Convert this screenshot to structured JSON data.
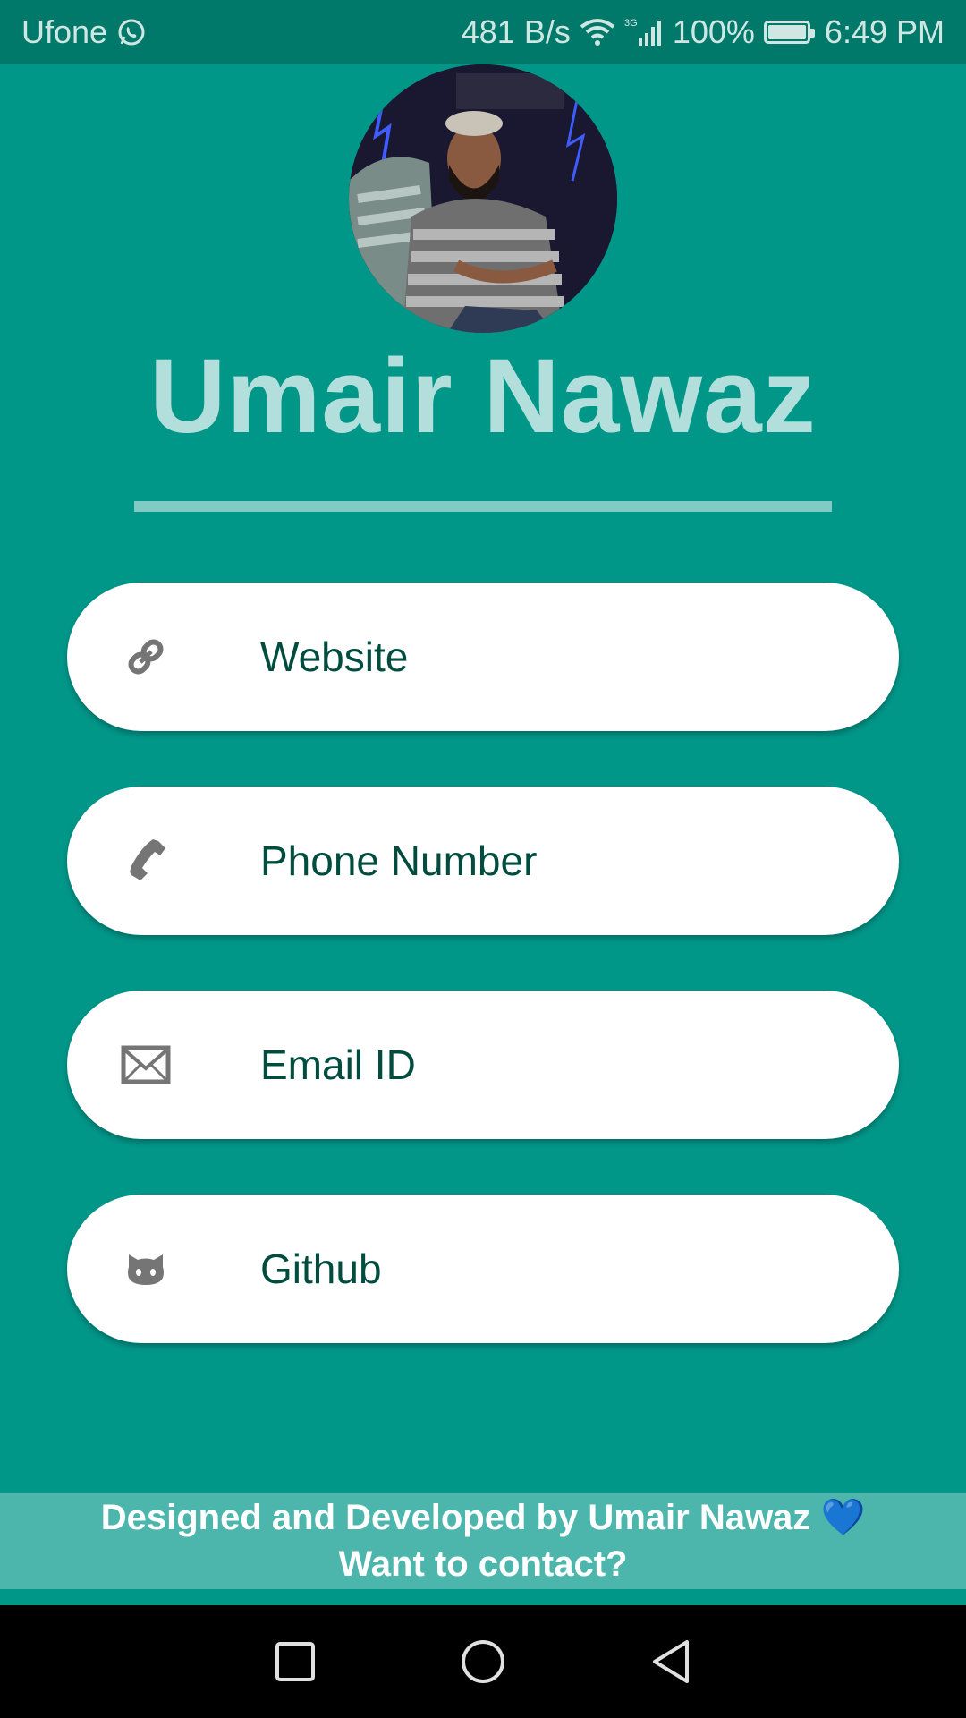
{
  "status_bar": {
    "carrier": "Ufone",
    "network_speed": "481 B/s",
    "network_type": "3G",
    "battery": "100%",
    "time": "6:49 PM",
    "icons": [
      "whatsapp-icon",
      "wifi-icon",
      "signal-icon",
      "battery-icon"
    ]
  },
  "profile": {
    "name": "Umair Nawaz"
  },
  "contacts": [
    {
      "label": "Website",
      "icon": "link-icon"
    },
    {
      "label": "Phone Number",
      "icon": "phone-icon"
    },
    {
      "label": "Email ID",
      "icon": "mail-icon"
    },
    {
      "label": "Github",
      "icon": "github-icon"
    }
  ],
  "footer": {
    "credit": "Designed and Developed by Umair Nawaz",
    "heart": "💙",
    "contact_prompt": "Want to contact?"
  },
  "nav": {
    "icons": [
      "recents-square-icon",
      "home-circle-icon",
      "back-triangle-icon"
    ]
  },
  "colors": {
    "background": "#009688",
    "status_bar": "#00796b",
    "name": "#b2dfdb",
    "divider": "#80cbc4",
    "card": "#ffffff",
    "card_text": "#004d40",
    "footer": "#4db6ac"
  }
}
